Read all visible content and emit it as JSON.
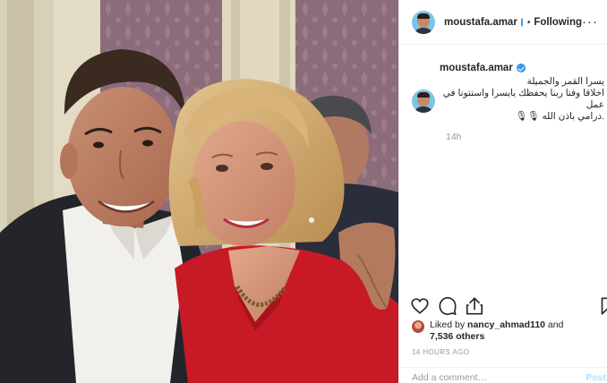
{
  "post": {
    "username": "moustafa.amar",
    "separator": "•",
    "follow_status": "Following",
    "more_label": "···"
  },
  "caption": {
    "username": "moustafa.amar",
    "line1": "يسرا القمر والجميلة",
    "line2": "اخلاقا وفنا ربنا يحفظك يايسرا واستنونا في عمل",
    "line3": ".درامي باذن الله 🎙🎙",
    "timestamp": "14h"
  },
  "likes": {
    "prefix": "Liked by ",
    "user": "nancy_ahmad110",
    "middle": " and",
    "others": "7,536 others"
  },
  "time_ago": "14 HOURS AGO",
  "comment": {
    "placeholder": "Add a comment…",
    "post_label": "Post"
  },
  "icons": {
    "like": "heart-icon",
    "comment": "comment-icon",
    "share": "share-icon",
    "save": "bookmark-icon",
    "verified": "verified-badge-icon"
  },
  "colors": {
    "verified": "#3897f0",
    "muted_text": "#999999",
    "post_button": "#b2dffc",
    "wallpaper": "#8a6a78",
    "dress": "#cc1d2a"
  }
}
